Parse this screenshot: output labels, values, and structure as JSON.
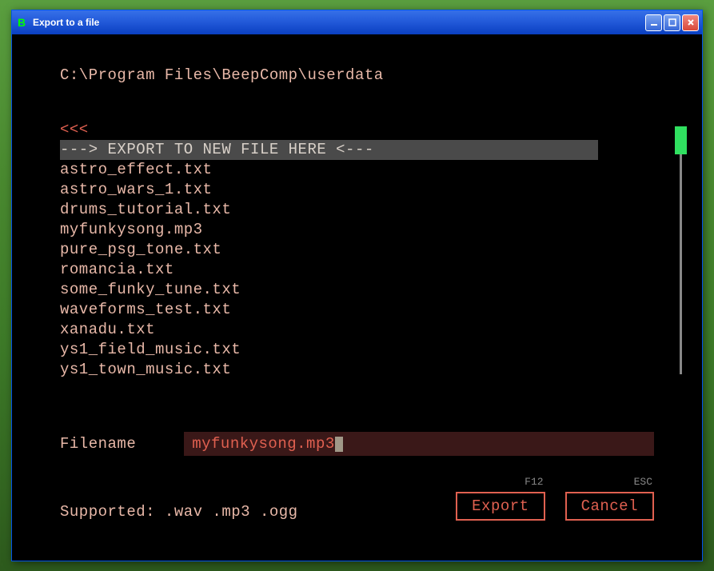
{
  "window": {
    "title": "Export to a file",
    "icon_letter": "B"
  },
  "path": "C:\\Program Files\\BeepComp\\userdata",
  "files": {
    "back": "<<<",
    "new_file_prompt": "---> EXPORT TO NEW FILE HERE <---",
    "items": [
      "astro_effect.txt",
      "astro_wars_1.txt",
      "drums_tutorial.txt",
      "myfunkysong.mp3",
      "pure_psg_tone.txt",
      "romancia.txt",
      "some_funky_tune.txt",
      "waveforms_test.txt",
      "xanadu.txt",
      "ys1_field_music.txt",
      "ys1_town_music.txt"
    ]
  },
  "filename": {
    "label": "Filename",
    "value": "myfunkysong.mp3"
  },
  "supported": {
    "label": "Supported: .wav .mp3 .ogg"
  },
  "buttons": {
    "export": {
      "label": "Export",
      "shortcut": "F12"
    },
    "cancel": {
      "label": "Cancel",
      "shortcut": "ESC"
    }
  }
}
